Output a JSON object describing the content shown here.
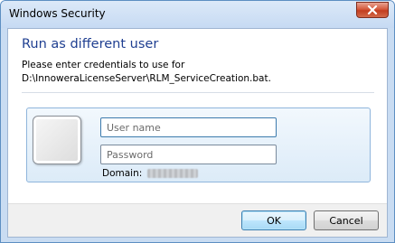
{
  "window": {
    "title": "Windows Security"
  },
  "dialog": {
    "heading": "Run as different user",
    "instruction_line1": "Please enter credentials to use for",
    "instruction_line2": "D:\\InnoweraLicenseServer\\RLM_ServiceCreation.bat."
  },
  "credentials": {
    "username_placeholder": "User name",
    "password_placeholder": "Password",
    "domain_label": "Domain:"
  },
  "buttons": {
    "ok_label": "OK",
    "cancel_label": "Cancel"
  },
  "colors": {
    "heading": "#1f3f91",
    "frame": "#c9dcf2",
    "close_button": "#c23e1f"
  },
  "icons": {
    "close": "close-icon",
    "user_tile": "user-tile-icon"
  }
}
